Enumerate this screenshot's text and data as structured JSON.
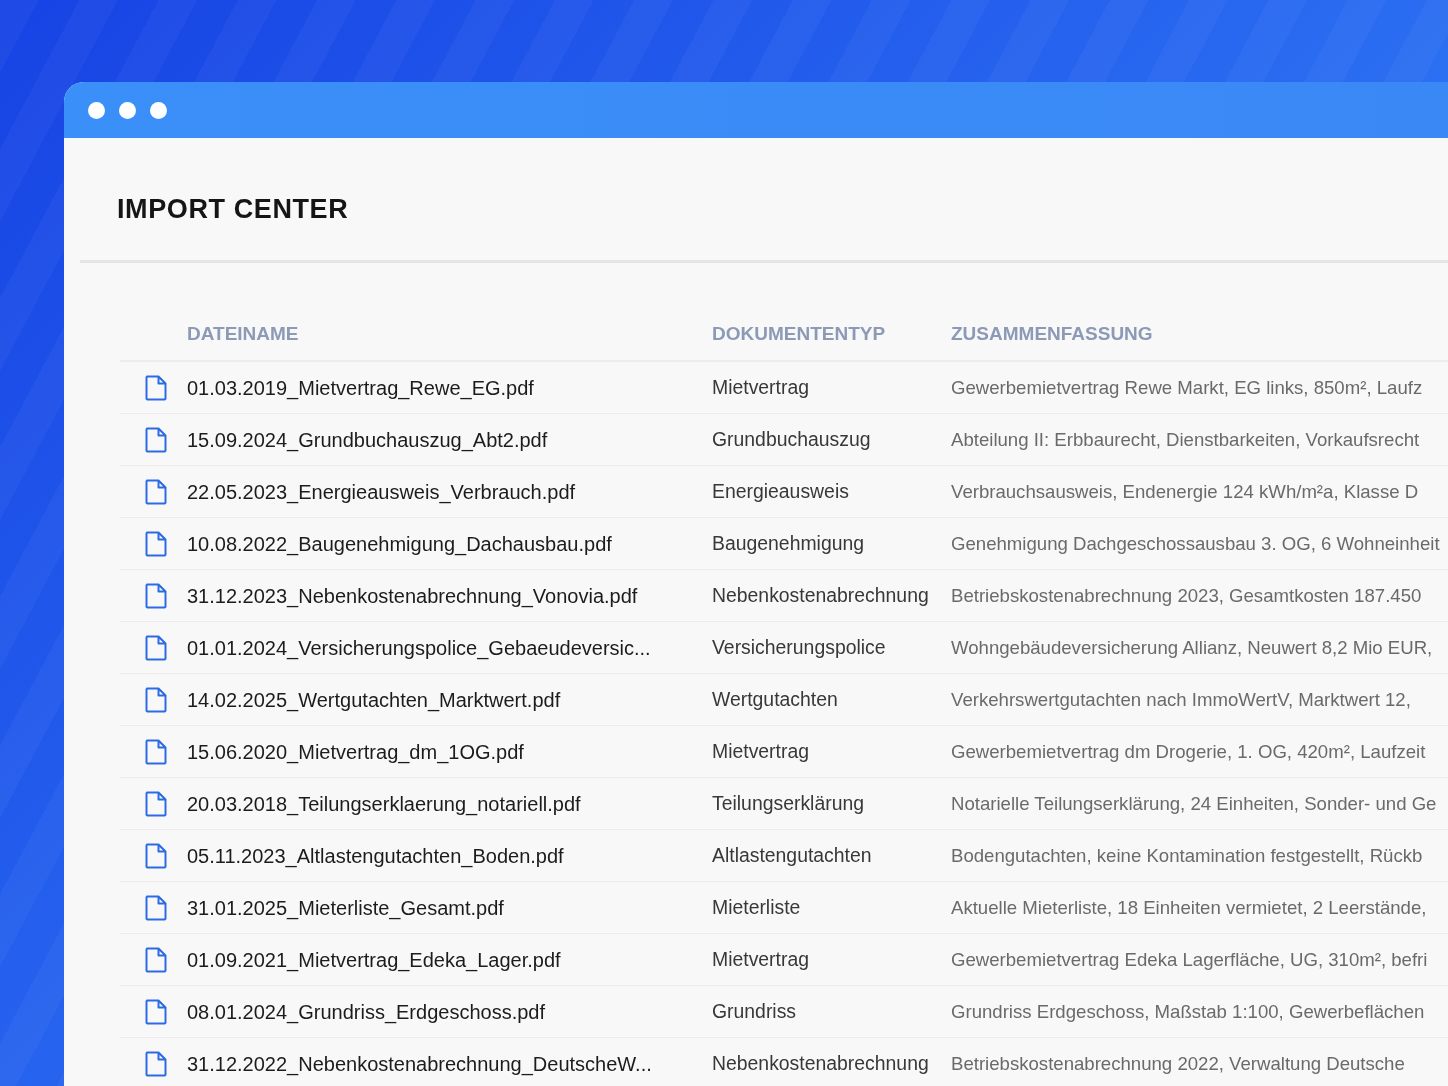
{
  "page_title": "IMPORT CENTER",
  "table": {
    "columns": [
      "DATEINAME",
      "DOKUMENTENTYP",
      "ZUSAMMENFASSUNG"
    ],
    "rows": [
      {
        "filename": "01.03.2019_Mietvertrag_Rewe_EG.pdf",
        "document_type": "Mietvertrag",
        "summary": "Gewerbemietvertrag Rewe Markt, EG links, 850m², Laufz"
      },
      {
        "filename": "15.09.2024_Grundbuchauszug_Abt2.pdf",
        "document_type": "Grundbuchauszug",
        "summary": "Abteilung II: Erbbaurecht, Dienstbarkeiten, Vorkaufsrecht"
      },
      {
        "filename": "22.05.2023_Energieausweis_Verbrauch.pdf",
        "document_type": "Energieausweis",
        "summary": "Verbrauchsausweis, Endenergie 124 kWh/m²a, Klasse D"
      },
      {
        "filename": "10.08.2022_Baugenehmigung_Dachausbau.pdf",
        "document_type": "Baugenehmigung",
        "summary": "Genehmigung Dachgeschossausbau 3. OG, 6 Wohneinheit"
      },
      {
        "filename": "31.12.2023_Nebenkostenabrechnung_Vonovia.pdf",
        "document_type": "Nebenkostenabrechnung",
        "summary": "Betriebskostenabrechnung 2023, Gesamtkosten 187.450"
      },
      {
        "filename": "01.01.2024_Versicherungspolice_Gebaeudeversic...",
        "document_type": "Versicherungspolice",
        "summary": "Wohngebäudeversicherung Allianz, Neuwert 8,2 Mio EUR,"
      },
      {
        "filename": "14.02.2025_Wertgutachten_Marktwert.pdf",
        "document_type": "Wertgutachten",
        "summary": "Verkehrswertgutachten nach ImmoWertV, Marktwert 12,"
      },
      {
        "filename": "15.06.2020_Mietvertrag_dm_1OG.pdf",
        "document_type": "Mietvertrag",
        "summary": "Gewerbemietvertrag dm Drogerie, 1. OG, 420m², Laufzeit"
      },
      {
        "filename": "20.03.2018_Teilungserklaerung_notariell.pdf",
        "document_type": "Teilungserklärung",
        "summary": "Notarielle Teilungserklärung, 24 Einheiten, Sonder- und Ge"
      },
      {
        "filename": "05.11.2023_Altlastengutachten_Boden.pdf",
        "document_type": "Altlastengutachten",
        "summary": "Bodengutachten, keine Kontamination festgestellt, Rückb"
      },
      {
        "filename": "31.01.2025_Mieterliste_Gesamt.pdf",
        "document_type": "Mieterliste",
        "summary": "Aktuelle Mieterliste, 18 Einheiten vermietet, 2 Leerstände,"
      },
      {
        "filename": "01.09.2021_Mietvertrag_Edeka_Lager.pdf",
        "document_type": "Mietvertrag",
        "summary": "Gewerbemietvertrag Edeka Lagerfläche, UG, 310m², befri"
      },
      {
        "filename": "08.01.2024_Grundriss_Erdgeschoss.pdf",
        "document_type": "Grundriss",
        "summary": "Grundriss Erdgeschoss, Maßstab 1:100, Gewerbeflächen"
      },
      {
        "filename": "31.12.2022_Nebenkostenabrechnung_DeutscheW...",
        "document_type": "Nebenkostenabrechnung",
        "summary": "Betriebskostenabrechnung 2022, Verwaltung Deutsche"
      }
    ]
  }
}
